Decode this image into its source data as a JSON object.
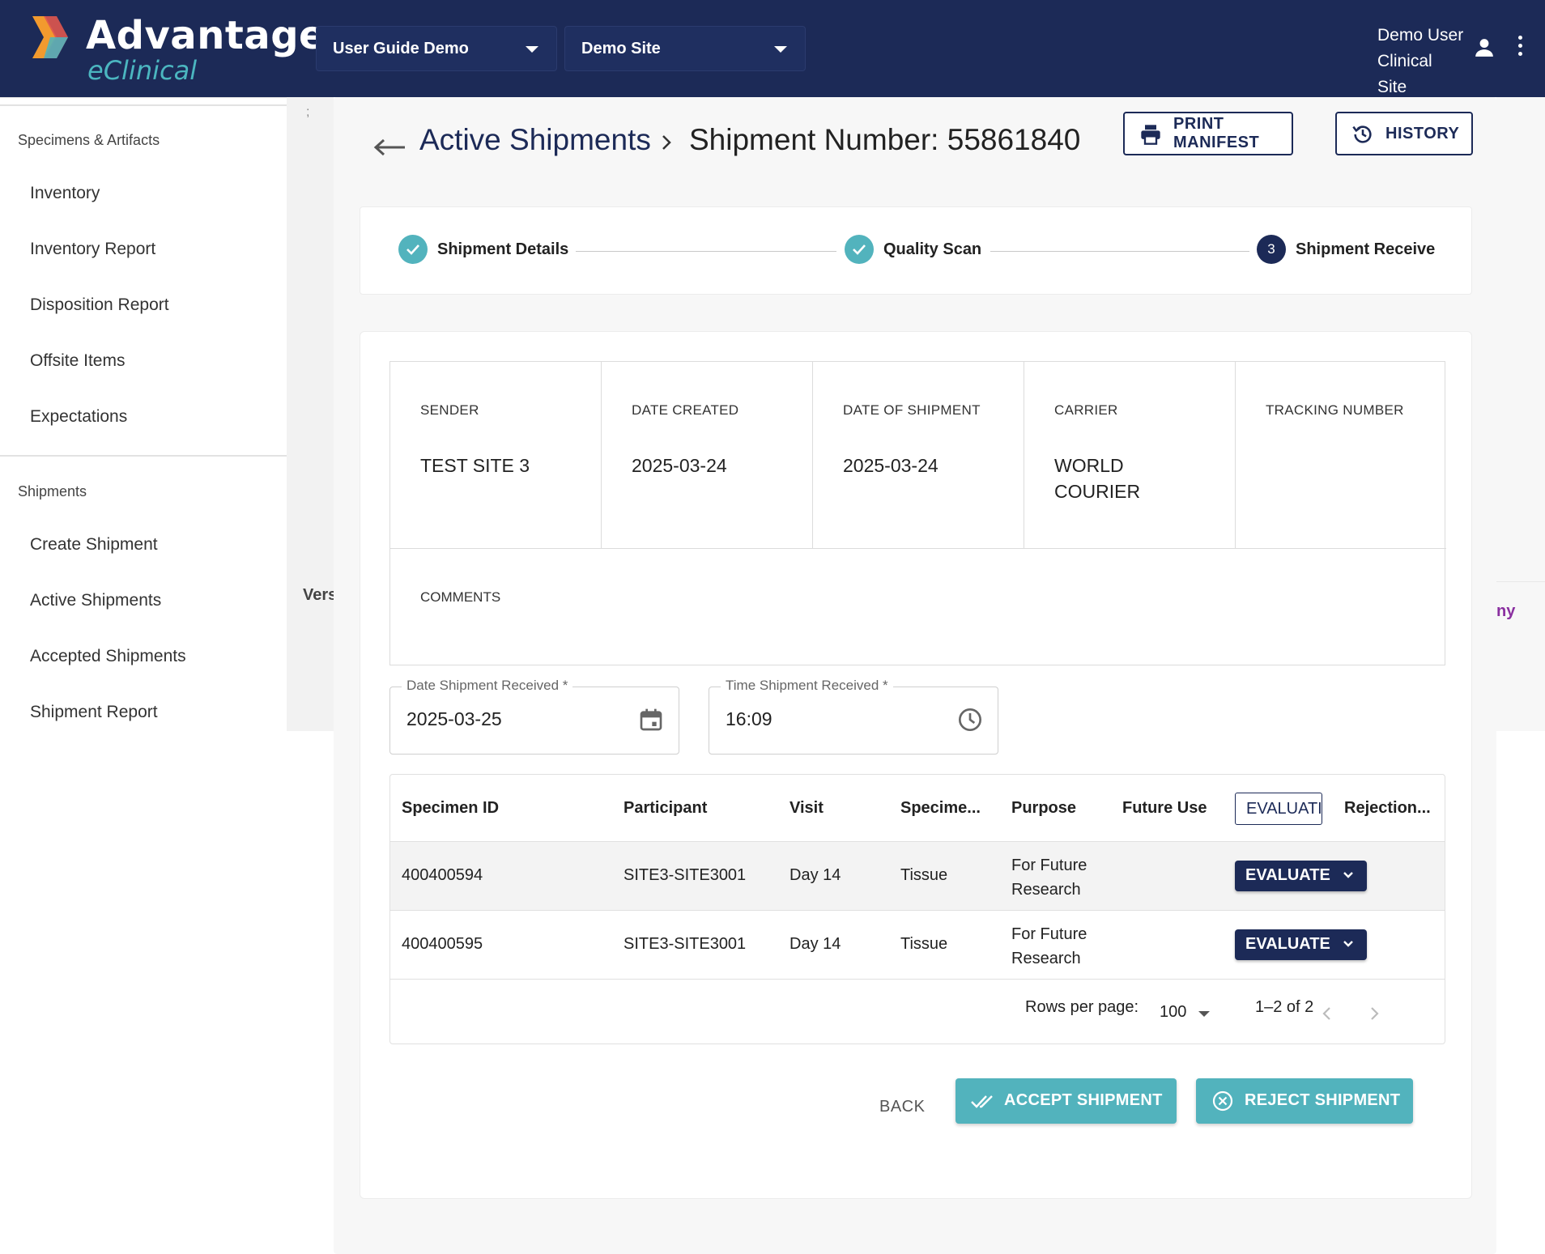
{
  "header": {
    "logo_title": "Advantage",
    "logo_sub": "eClinical",
    "study_select": "User Guide Demo",
    "site_select": "Demo Site",
    "user_name": "Demo User",
    "user_role": "Clinical Site",
    "colors": {
      "bar": "#1c2a57",
      "accent": "#52b3bd"
    }
  },
  "sidebar": {
    "section1": "Specimens & Artifacts",
    "items1": [
      "Inventory",
      "Inventory Report",
      "Disposition Report",
      "Offsite Items",
      "Expectations"
    ],
    "section2": "Shipments",
    "items2": [
      "Create Shipment",
      "Active Shipments",
      "Accepted Shipments",
      "Shipment Report"
    ]
  },
  "background_fragments": {
    "semicolon": ";",
    "version_fragment": "Vers",
    "right_fragment": "ny"
  },
  "page": {
    "breadcrumb_link": "Active Shipments",
    "breadcrumb_current": "Shipment Number: 55861840",
    "print_label": "PRINT MANIFEST",
    "history_label": "HISTORY"
  },
  "stepper": {
    "steps": [
      {
        "label": "Shipment Details",
        "state": "complete",
        "icon": "check-icon"
      },
      {
        "label": "Quality Scan",
        "state": "complete",
        "icon": "check-icon"
      },
      {
        "label": "Shipment Receive",
        "state": "active",
        "number": "3"
      }
    ]
  },
  "shipment_info": {
    "sender_label": "SENDER",
    "sender": "TEST SITE 3",
    "created_label": "DATE CREATED",
    "created": "2025-03-24",
    "shipped_label": "DATE OF SHIPMENT",
    "shipped": "2025-03-24",
    "carrier_label": "CARRIER",
    "carrier": "WORLD COURIER",
    "tracking_label": "TRACKING NUMBER",
    "tracking": "",
    "comments_label": "COMMENTS",
    "comments": ""
  },
  "form": {
    "date_label": "Date Shipment Received *",
    "date_value": "2025-03-25",
    "time_label": "Time Shipment Received *",
    "time_value": "16:09"
  },
  "table": {
    "columns": [
      "Specimen ID",
      "Participant",
      "Visit",
      "Specime...",
      "Purpose",
      "Future Use",
      "EVALUATI",
      "Rejection..."
    ],
    "rows": [
      {
        "specimen_id": "400400594",
        "participant": "SITE3-SITE3001",
        "visit": "Day 14",
        "specimen": "Tissue",
        "purpose": "For Future Research",
        "future_use": "",
        "evaluate": "EVALUATE",
        "rejection": ""
      },
      {
        "specimen_id": "400400595",
        "participant": "SITE3-SITE3001",
        "visit": "Day 14",
        "specimen": "Tissue",
        "purpose": "For Future Research",
        "future_use": "",
        "evaluate": "EVALUATE",
        "rejection": ""
      }
    ],
    "rows_per_page_label": "Rows per page:",
    "rows_per_page": "100",
    "range": "1–2 of 2"
  },
  "actions": {
    "back": "BACK",
    "accept": "ACCEPT SHIPMENT",
    "reject": "REJECT SHIPMENT"
  }
}
